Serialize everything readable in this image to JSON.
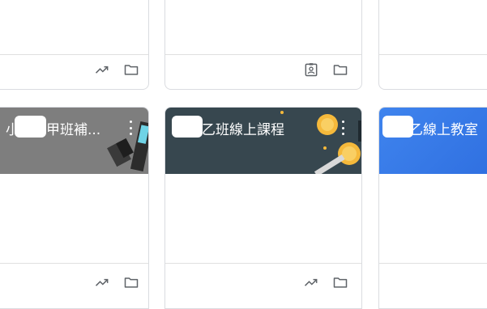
{
  "cards": [
    {
      "id": "top-left",
      "footer_icons": [
        "trending-up-icon",
        "folder-icon"
      ]
    },
    {
      "id": "top-middle",
      "footer_icons": [
        "assignment-ind-icon",
        "folder-icon"
      ]
    },
    {
      "id": "top-right",
      "footer_icons": []
    },
    {
      "id": "bottom-left",
      "title_visible": "小  甲班補...",
      "title_suffix": "甲班補...",
      "title_prefix": "小",
      "banner_color": "#7e7e7e",
      "footer_icons": [
        "trending-up-icon",
        "folder-icon"
      ]
    },
    {
      "id": "bottom-middle",
      "title_suffix": "乙班線上課程",
      "banner_color": "#37474f",
      "footer_icons": [
        "trending-up-icon",
        "folder-icon"
      ]
    },
    {
      "id": "bottom-right",
      "title_suffix": "乙線上教室",
      "banner_color": "#3f84ee",
      "footer_icons": []
    }
  ]
}
